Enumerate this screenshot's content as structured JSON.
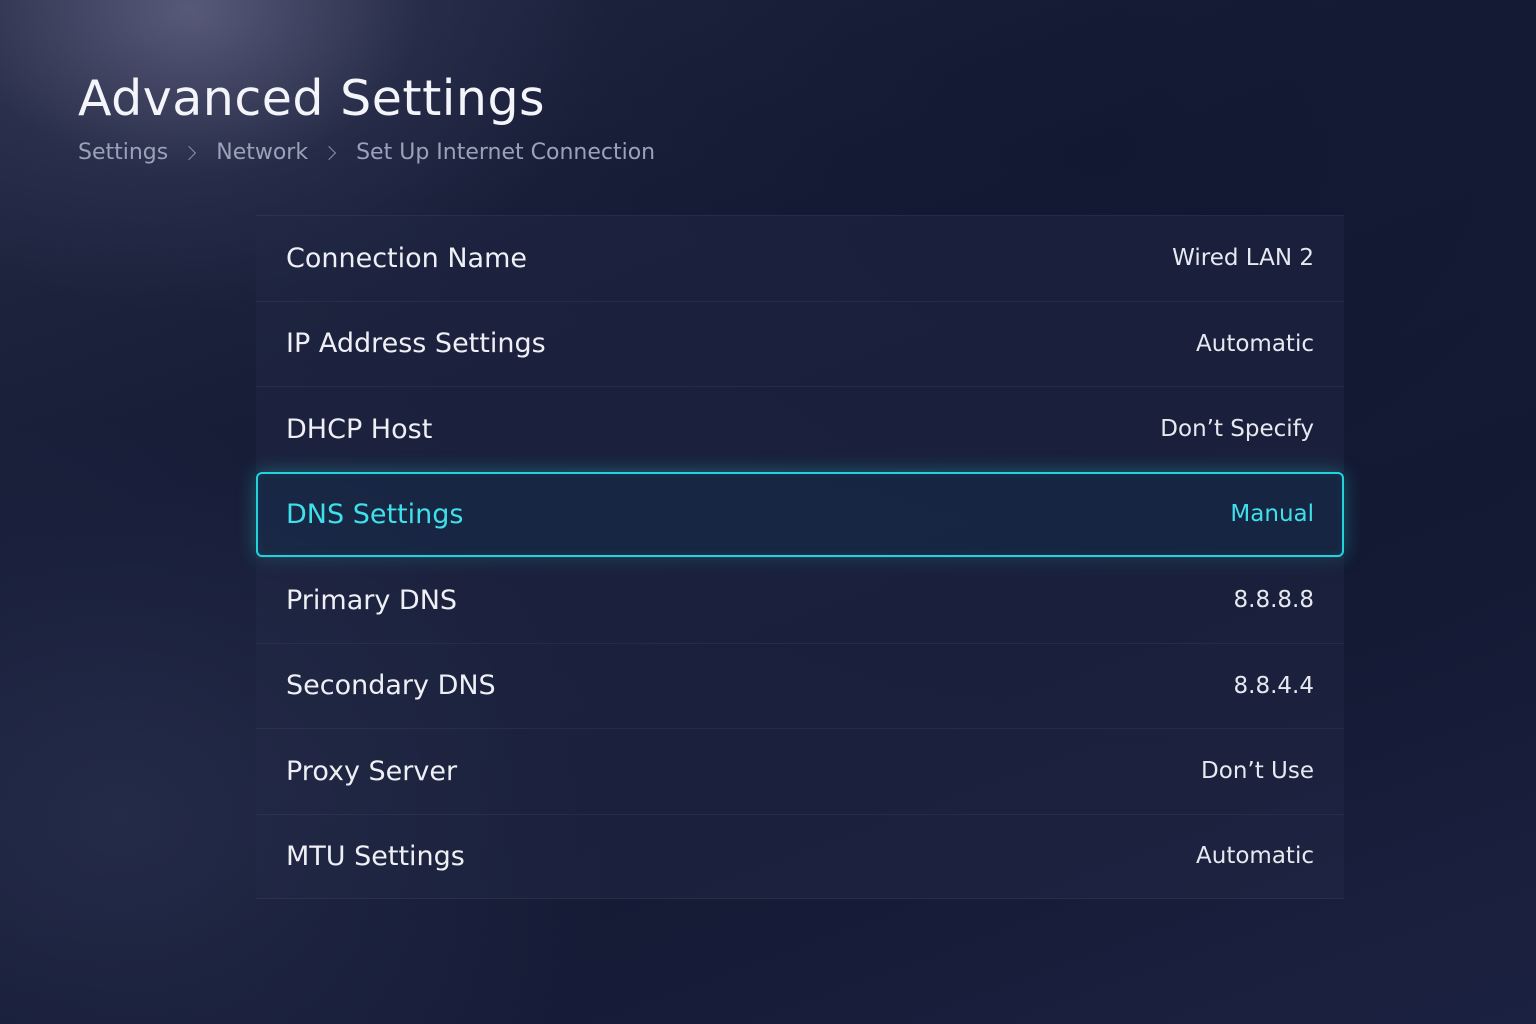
{
  "header": {
    "title": "Advanced Settings",
    "breadcrumb": [
      "Settings",
      "Network",
      "Set Up Internet Connection"
    ]
  },
  "settings": [
    {
      "label": "Connection Name",
      "value": "Wired LAN 2"
    },
    {
      "label": "IP Address Settings",
      "value": "Automatic"
    },
    {
      "label": "DHCP Host",
      "value": "Don’t Specify"
    },
    {
      "label": "DNS Settings",
      "value": "Manual",
      "selected": true
    },
    {
      "label": "Primary DNS",
      "value": "8.8.8.8"
    },
    {
      "label": "Secondary DNS",
      "value": "8.8.4.4"
    },
    {
      "label": "Proxy Server",
      "value": "Don’t Use"
    },
    {
      "label": "MTU Settings",
      "value": "Automatic"
    }
  ],
  "colors": {
    "accent": "#22d3dc",
    "background": "#161c36"
  }
}
